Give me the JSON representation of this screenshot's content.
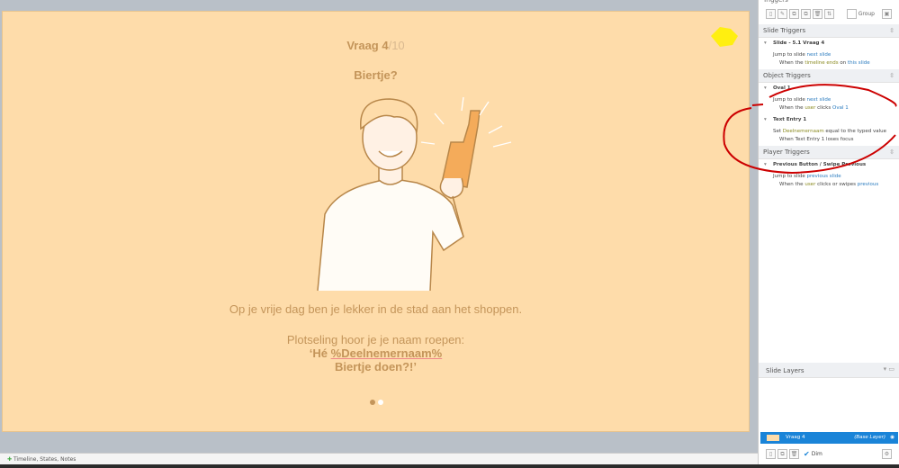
{
  "slide": {
    "question_label": "Vraag 4",
    "question_total": "/10",
    "heading": "Biertje?",
    "paragraph1": "Op je vrije dag ben je lekker in de stad aan het shoppen.",
    "paragraph2_line1": "Plotseling hoor je je naam roepen:",
    "paragraph2_line2_pre": "‘Hé ",
    "paragraph2_variable": "%Deelnemernaam%",
    "paragraph2_line3": "Biertje doen?!’",
    "dots_total": 2,
    "active_dot": 1,
    "background": "#fedcaa"
  },
  "panel": {
    "title": "Triggers",
    "group_label": "Group",
    "slide_triggers": {
      "header": "Slide Triggers",
      "object": "Slide - 5.1 Vraag 4",
      "action": "Jump to slide ",
      "action_target": "next slide",
      "cond_pre": "When the ",
      "cond_event": "timeline ends",
      "cond_mid": " on ",
      "cond_obj": "this slide"
    },
    "object_triggers": {
      "header": "Object Triggers",
      "oval": {
        "object": "Oval 1",
        "action": "Jump to slide ",
        "action_target": "next slide",
        "cond_pre": "When the ",
        "cond_user": "user",
        "cond_event": " clicks ",
        "cond_obj": "Oval 1"
      },
      "text_entry": {
        "object": "Text Entry 1",
        "action_pre": "Set ",
        "variable": "Deelnemernaam",
        "action_post": " equal to the typed value",
        "cond": "When Text Entry 1 loses focus"
      }
    },
    "player_triggers": {
      "header": "Player Triggers",
      "object": "Previous Button / Swipe Previous",
      "action": "Jump to slide ",
      "action_target": "previous slide",
      "cond_pre": "When the ",
      "cond_user": "user",
      "cond_event": " clicks or swipes ",
      "cond_obj": "previous"
    },
    "layers": {
      "header": "Slide Layers",
      "layer_name": "Vraag 4",
      "layer_type": "(Base Layer)",
      "dim_label": "Dim"
    }
  },
  "footer": {
    "label": "Timeline, States, Notes"
  }
}
